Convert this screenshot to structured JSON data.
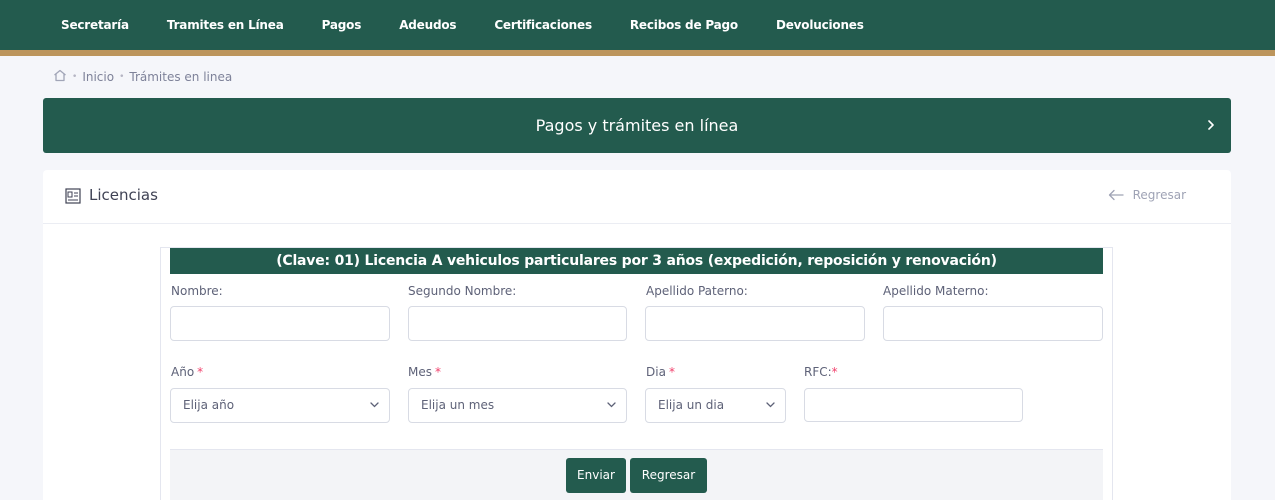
{
  "nav": {
    "items": [
      "Secretaría",
      "Tramites en Línea",
      "Pagos",
      "Adeudos",
      "Certificaciones",
      "Recibos de Pago",
      "Devoluciones"
    ]
  },
  "breadcrumb": {
    "home_icon": "home-icon",
    "items": [
      "Inicio",
      "Trámites en linea"
    ]
  },
  "banner": {
    "title": "Pagos y trámites en línea"
  },
  "card": {
    "title": "Licencias",
    "icon": "id-card-icon",
    "back_label": "Regresar"
  },
  "form": {
    "title": "(Clave: 01) Licencia A vehiculos particulares por 3 años (expedición, reposición y renovación)",
    "fields": {
      "nombre": {
        "label": "Nombre:",
        "value": ""
      },
      "segundo_nombre": {
        "label": "Segundo Nombre:",
        "value": ""
      },
      "apellido_paterno": {
        "label": "Apellido Paterno:",
        "value": ""
      },
      "apellido_materno": {
        "label": "Apellido Materno:",
        "value": ""
      },
      "anio": {
        "label": "Año",
        "required_mark": "*",
        "selected": "Elija año"
      },
      "mes": {
        "label": "Mes",
        "required_mark": "*",
        "selected": "Elija un mes"
      },
      "dia": {
        "label": "Dia",
        "required_mark": "*",
        "selected": "Elija un dia"
      },
      "rfc": {
        "label": "RFC:",
        "required_mark": "*",
        "value": ""
      }
    },
    "buttons": {
      "submit": "Enviar",
      "back": "Regresar"
    }
  },
  "colors": {
    "primary": "#235b4e",
    "gold": "#bc955c",
    "required": "#f1416c"
  }
}
